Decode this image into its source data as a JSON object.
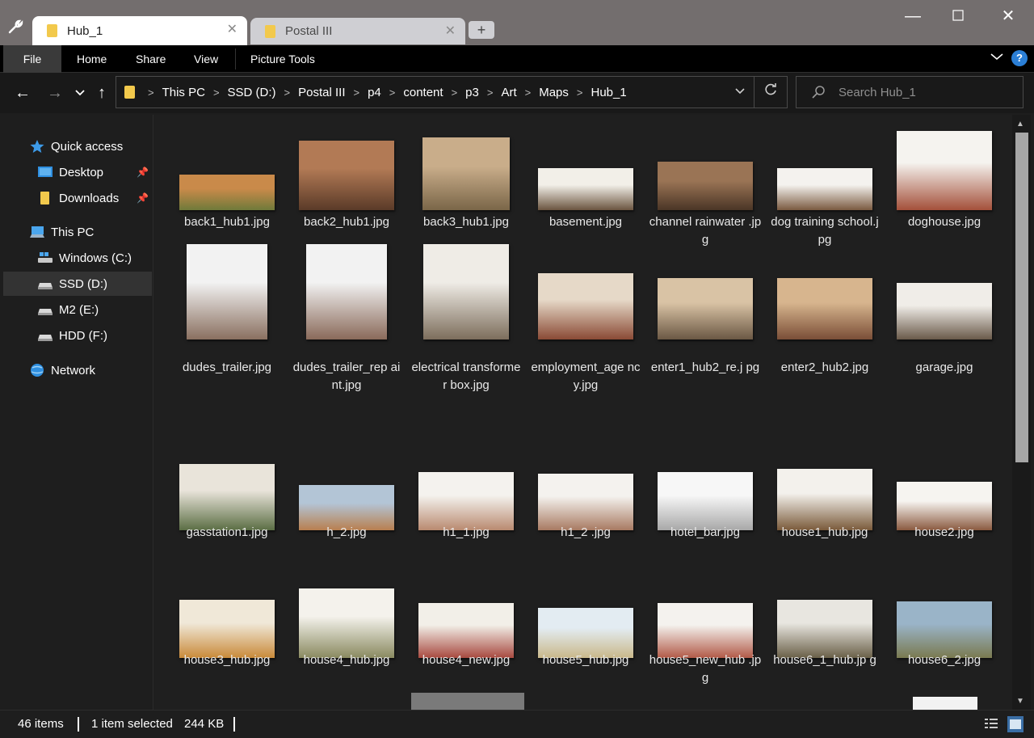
{
  "tabs": [
    {
      "label": "Hub_1",
      "active": true
    },
    {
      "label": "Postal III",
      "active": false
    }
  ],
  "ribbon": {
    "tabs": [
      "File",
      "Home",
      "Share",
      "View",
      "Picture Tools"
    ]
  },
  "address": {
    "crumbs": [
      "This PC",
      "SSD (D:)",
      "Postal III",
      "p4",
      "content",
      "p3",
      "Art",
      "Maps",
      "Hub_1"
    ]
  },
  "search": {
    "placeholder": "Search Hub_1"
  },
  "sidebar": {
    "items": [
      {
        "label": "Quick access",
        "icon": "star-icon",
        "pinned": false
      },
      {
        "label": "Desktop",
        "icon": "desktop-icon",
        "pinned": true
      },
      {
        "label": "Downloads",
        "icon": "folder-icon",
        "pinned": true
      },
      {
        "label": "This PC",
        "icon": "computer-icon",
        "pinned": false
      },
      {
        "label": "Windows (C:)",
        "icon": "drive-windows-icon",
        "pinned": false
      },
      {
        "label": "SSD (D:)",
        "icon": "drive-icon",
        "pinned": false,
        "selected": true
      },
      {
        "label": "M2 (E:)",
        "icon": "drive-icon",
        "pinned": false
      },
      {
        "label": "HDD (F:)",
        "icon": "drive-icon",
        "pinned": false
      },
      {
        "label": "Network",
        "icon": "network-icon",
        "pinned": false
      }
    ]
  },
  "files": [
    {
      "name": "back1_hub1.jpg",
      "colors": [
        "#c98a4a",
        "#6f7a3a"
      ]
    },
    {
      "name": "back2_hub1.jpg",
      "colors": [
        "#b27a55",
        "#5a3a28"
      ]
    },
    {
      "name": "back3_hub1.jpg",
      "colors": [
        "#c9ad8a",
        "#7a6648"
      ]
    },
    {
      "name": "basement.jpg",
      "colors": [
        "#f2efe8",
        "#6b5540"
      ]
    },
    {
      "name": "channel rainwater .jpg",
      "colors": [
        "#9a7455",
        "#4a3526"
      ]
    },
    {
      "name": "dog training school.jpg",
      "colors": [
        "#f4f2ee",
        "#7a5a40"
      ]
    },
    {
      "name": "doghouse.jpg",
      "colors": [
        "#f5f3ef",
        "#a4503a"
      ]
    },
    {
      "name": "dudes_trailer.jpg",
      "colors": [
        "#f2f2f2",
        "#8a7060"
      ]
    },
    {
      "name": "dudes_trailer_rep aint.jpg",
      "colors": [
        "#f2f2f2",
        "#8a6a5a"
      ]
    },
    {
      "name": "electrical transformer box.jpg",
      "colors": [
        "#efece6",
        "#7d6e5c"
      ]
    },
    {
      "name": "employment_age ncy.jpg",
      "colors": [
        "#e6d9c8",
        "#8a4a35"
      ]
    },
    {
      "name": "enter1_hub2_re.j pg",
      "colors": [
        "#d9c3a5",
        "#6b5844"
      ]
    },
    {
      "name": "enter2_hub2.jpg",
      "colors": [
        "#d7b58e",
        "#7a4e37"
      ]
    },
    {
      "name": "garage.jpg",
      "colors": [
        "#f0ede8",
        "#6a5a4a"
      ]
    },
    {
      "name": "gasstation1.jpg",
      "colors": [
        "#e9e4da",
        "#5b6e44"
      ]
    },
    {
      "name": "h_2.jpg",
      "colors": [
        "#b3c5d6",
        "#b87f4f"
      ]
    },
    {
      "name": "h1_1.jpg",
      "colors": [
        "#f4f2ee",
        "#b98a70"
      ]
    },
    {
      "name": "h1_2 .jpg",
      "colors": [
        "#f4f2ee",
        "#a87a62"
      ]
    },
    {
      "name": "hotel_bar.jpg",
      "colors": [
        "#f7f7f7",
        "#a8a8a8"
      ]
    },
    {
      "name": "house1_hub.jpg",
      "colors": [
        "#f3f1ec",
        "#7a5a3a"
      ]
    },
    {
      "name": "house2.jpg",
      "colors": [
        "#f6f4f0",
        "#8a5a40"
      ]
    },
    {
      "name": "house3_hub.jpg",
      "colors": [
        "#f0e8d8",
        "#c98a3a"
      ]
    },
    {
      "name": "house4_hub.jpg",
      "colors": [
        "#f4f2ec",
        "#8a8a60"
      ]
    },
    {
      "name": "house4_new.jpg",
      "colors": [
        "#f2efe8",
        "#a84a40"
      ]
    },
    {
      "name": "house5_hub.jpg",
      "colors": [
        "#e3ecf2",
        "#c9b88a"
      ]
    },
    {
      "name": "house5_new_hub .jpg",
      "colors": [
        "#f4f2ee",
        "#b25a48"
      ]
    },
    {
      "name": "house6_1_hub.jp g",
      "colors": [
        "#e8e6e0",
        "#6a6048"
      ]
    },
    {
      "name": "house6_2.jpg",
      "colors": [
        "#9ab4c8",
        "#7a7a50"
      ]
    }
  ],
  "status": {
    "count": "46 items",
    "selection": "1 item selected",
    "size": "244 KB"
  }
}
